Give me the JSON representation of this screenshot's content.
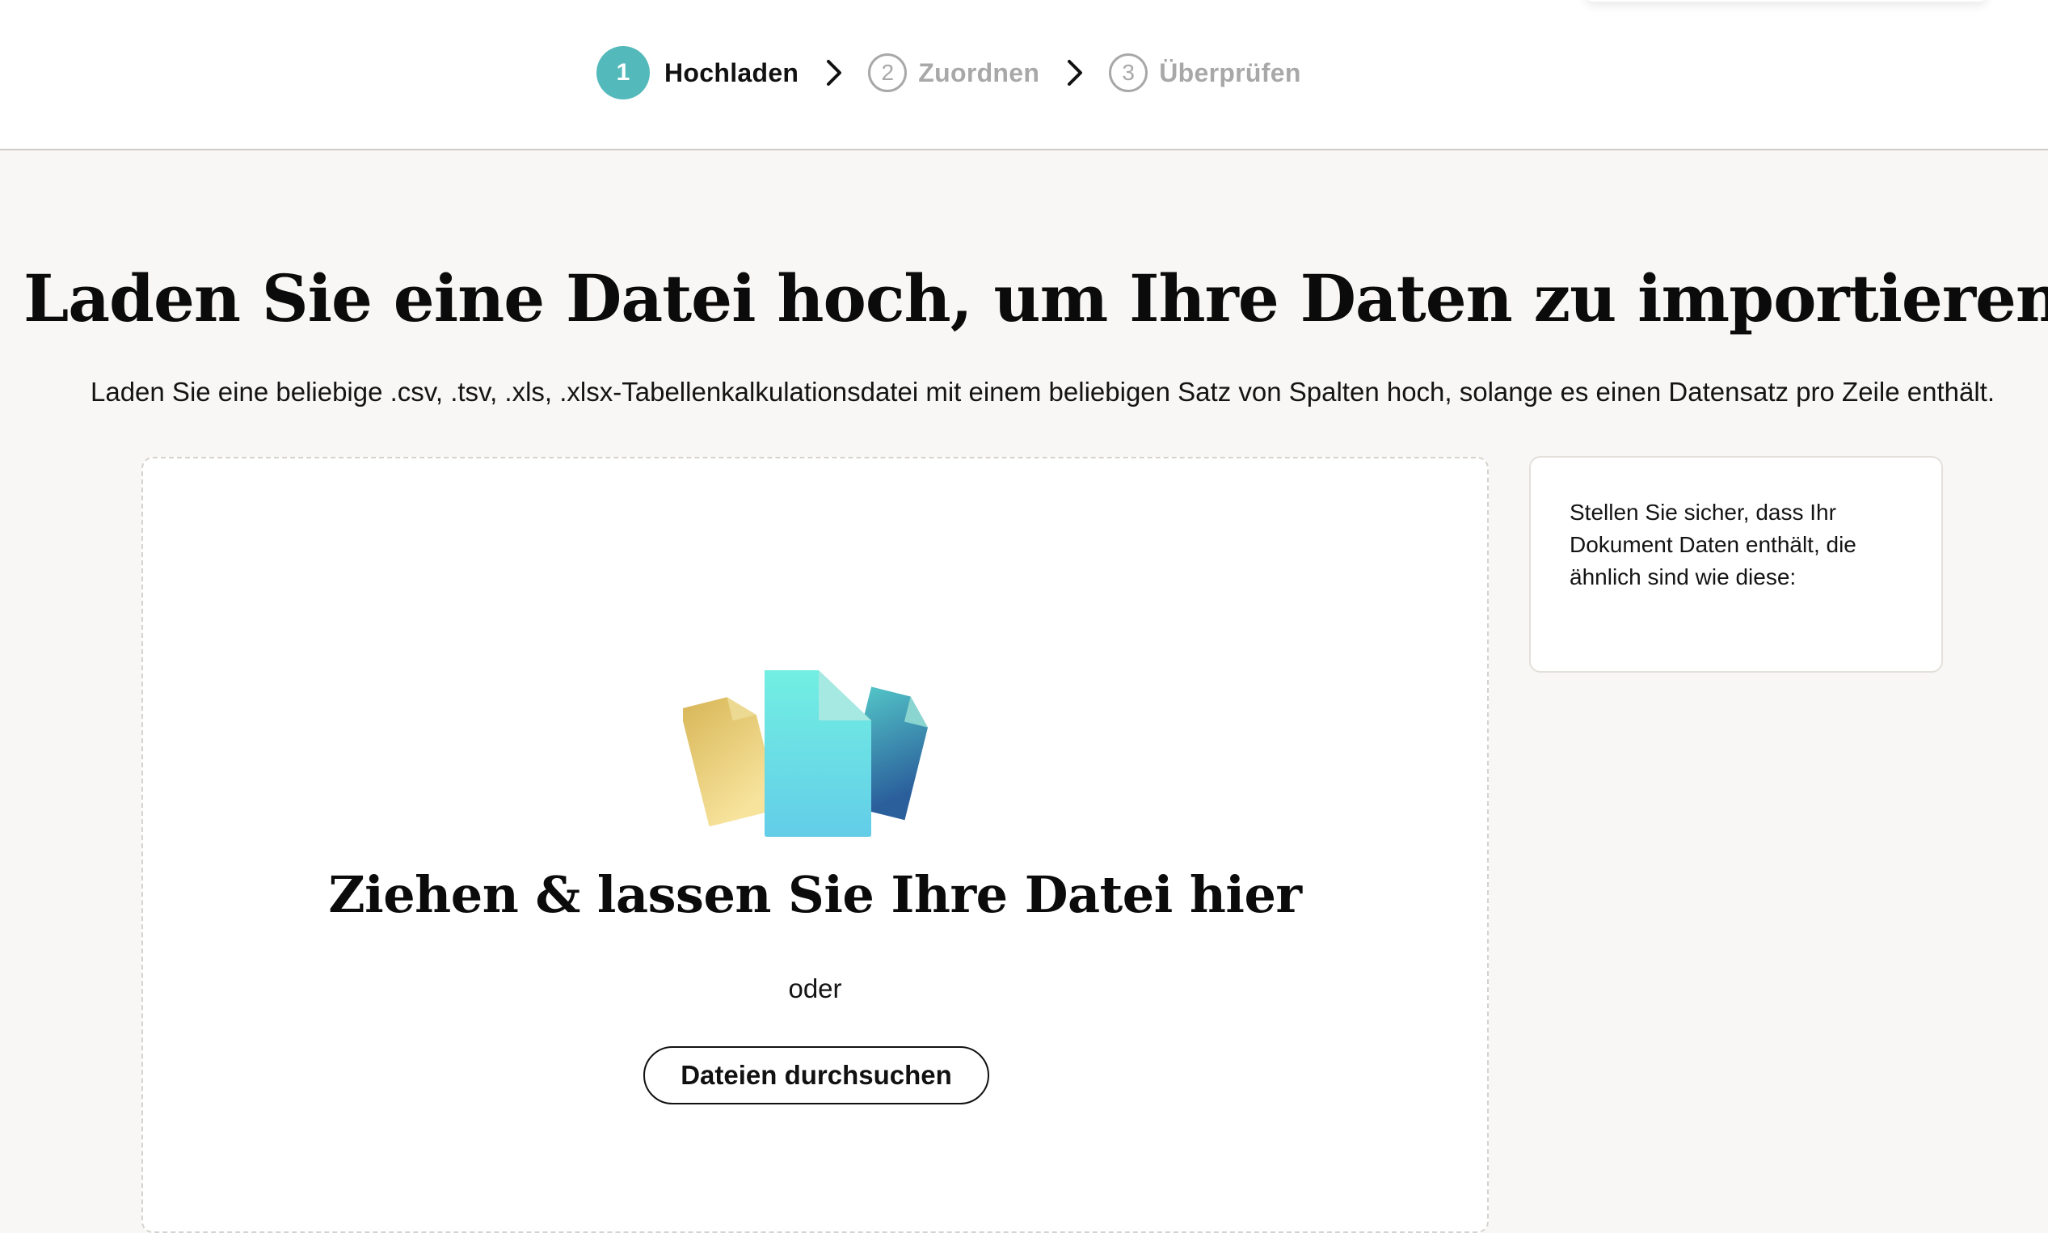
{
  "stepper": {
    "steps": [
      {
        "number": "1",
        "label": "Hochladen",
        "state": "active"
      },
      {
        "number": "2",
        "label": "Zuordnen",
        "state": "inactive"
      },
      {
        "number": "3",
        "label": "Überprüfen",
        "state": "inactive"
      }
    ],
    "separator_icon": "chevron-right-icon"
  },
  "main": {
    "title": "Laden Sie eine Datei hoch, um Ihre Daten zu importieren",
    "subtitle": "Laden Sie eine beliebige .csv, .tsv, .xls, .xlsx-Tabellenkalkulationsdatei mit einem beliebigen Satz von Spalten hoch, solange es einen Datensatz pro Zeile enthält."
  },
  "dropzone": {
    "illustration_icon": "files-illustration-icon",
    "title": "Ziehen & lassen Sie Ihre Datei hier",
    "or_label": "oder",
    "browse_label": "Dateien durchsuchen"
  },
  "hint": {
    "text": "Stellen Sie sicher, dass Ihr Dokument Daten enthält, die ähnlich sind wie diese:"
  },
  "colors": {
    "accent": "#54b9bb",
    "inactive": "#a8a8a8",
    "background": "#f8f7f5"
  }
}
